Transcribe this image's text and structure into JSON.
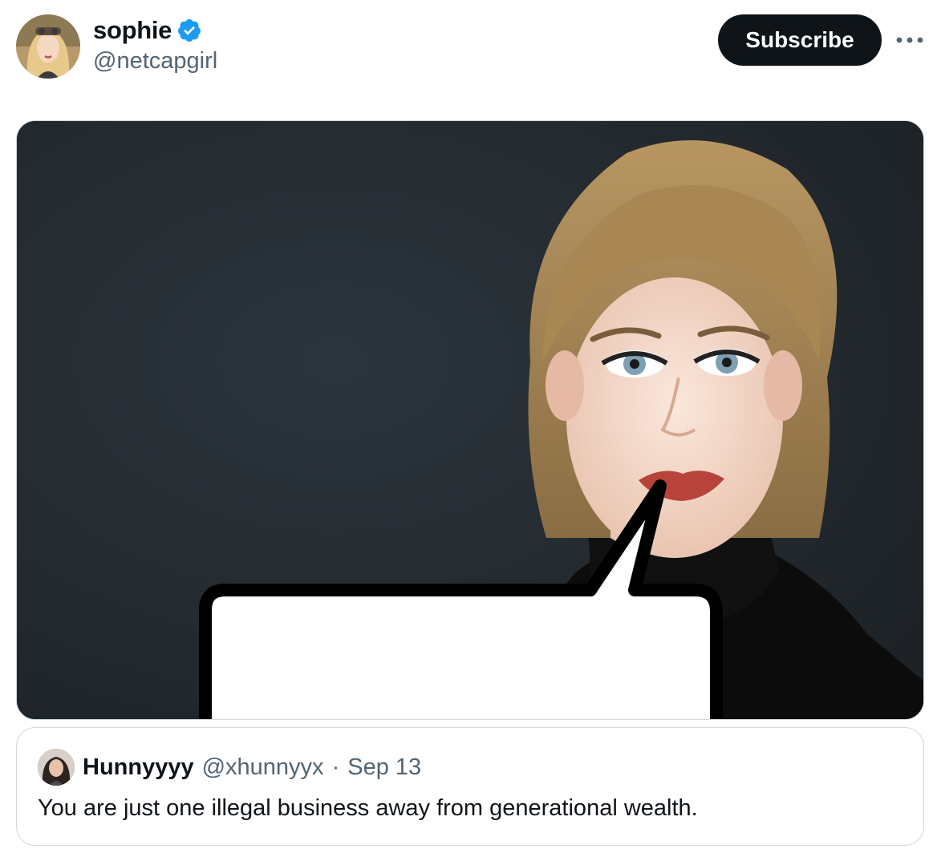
{
  "author": {
    "display_name": "sophie",
    "handle": "@netcapgirl",
    "verified": true,
    "verified_color": "#1d9bf0"
  },
  "actions": {
    "subscribe_label": "Subscribe",
    "more_icon": "more-horizontal-icon"
  },
  "media": {
    "image_name": "photo-with-blank-speech-bubble"
  },
  "quote": {
    "display_name": "Hunnyyyy",
    "handle": "@xhunnyyx",
    "separator": "·",
    "date": "Sep 13",
    "text": "You are just one illegal business away from generational wealth."
  },
  "colors": {
    "primary_text": "#0f1419",
    "secondary_text": "#536471",
    "border": "#cfd9de",
    "button_bg": "#0f1419"
  }
}
